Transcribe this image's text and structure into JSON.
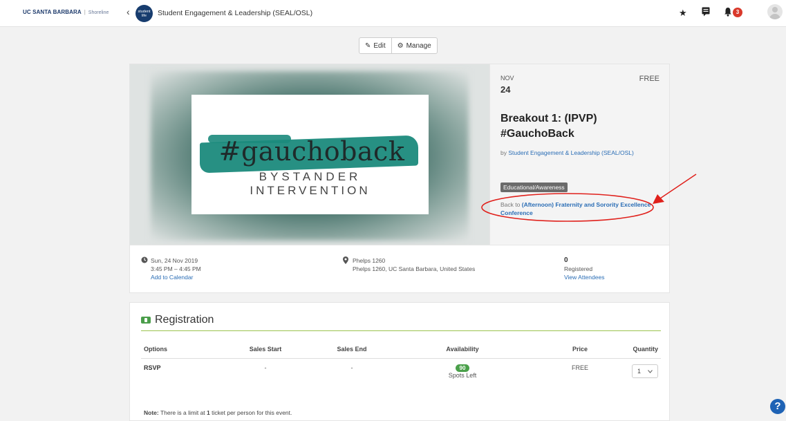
{
  "nav": {
    "logo_main": "UC SANTA BARBARA",
    "logo_sep": "|",
    "logo_sub": "Shoreline",
    "back_glyph": "‹",
    "org_badge": "student life",
    "org_name": "Student Engagement & Leadership (SEAL/OSL)",
    "icons": [
      "star-icon",
      "message-icon",
      "bell-icon"
    ],
    "notification_count": "3"
  },
  "toolbar": {
    "edit_label": "Edit",
    "manage_label": "Manage"
  },
  "event": {
    "image_text": {
      "hashtag": "#gauchoback",
      "line1": "BYSTANDER",
      "line2": "INTERVENTION"
    },
    "month": "NOV",
    "day": "24",
    "price": "FREE",
    "title": "Breakout 1: (IPVP) #GauchoBack",
    "by_prefix": "by",
    "by_org": "Student Engagement & Leadership (SEAL/OSL)",
    "category": "Educational/Awareness",
    "back_prefix": "Back to",
    "back_link": "(Afternoon) Fraternity and Sorority Excellence Conference",
    "date": "Sun, 24 Nov 2019",
    "time": "3:45 PM – 4:45 PM",
    "add_calendar": "Add to Calendar",
    "location_name": "Phelps 1260",
    "location_full": "Phelps 1260, UC Santa Barbara, United States",
    "registered_count": "0",
    "registered_label": "Registered",
    "view_attendees": "View Attendees"
  },
  "registration": {
    "title": "Registration",
    "columns": [
      "Options",
      "Sales Start",
      "Sales End",
      "Availability",
      "Price",
      "Quantity"
    ],
    "rows": [
      {
        "option": "RSVP",
        "sales_start": "-",
        "sales_end": "-",
        "spots": "90",
        "spots_label": "Spots Left",
        "price": "FREE",
        "quantity": "1"
      }
    ],
    "note_label": "Note:",
    "note_pre": "There is a limit at",
    "note_num": "1",
    "note_post": "ticket per person for this event."
  },
  "help_glyph": "?",
  "colors": {
    "link": "#2a6db5",
    "accent_green": "#4aa04a",
    "annotation_red": "#e0201b",
    "badge_red": "#d9392b"
  }
}
